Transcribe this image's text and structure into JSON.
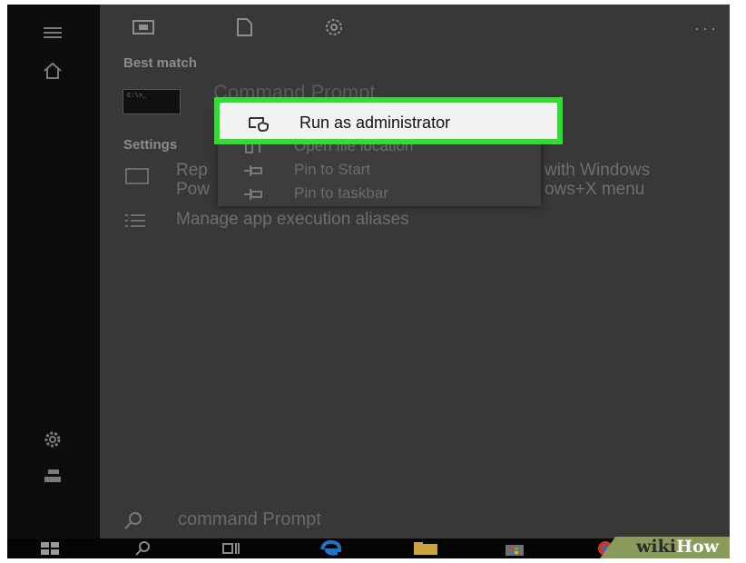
{
  "best_match": {
    "heading": "Best match",
    "app_title": "Command Prompt",
    "thumb_text": "C:\\>_"
  },
  "context_menu": {
    "items": [
      {
        "label": "Run as administrator",
        "icon": "shield-window-icon",
        "highlighted": true
      },
      {
        "label": "Open file location",
        "icon": "folder-icon",
        "highlighted": false
      },
      {
        "label": "Pin to Start",
        "icon": "pin-icon",
        "highlighted": false
      },
      {
        "label": "Pin to taskbar",
        "icon": "pin-icon",
        "highlighted": false
      }
    ],
    "highlight_color": "#2de02d"
  },
  "settings": {
    "heading": "Settings",
    "item1_line1_left": "Rep",
    "item1_line1_right": "with Windows",
    "item1_line2_left": "Pow",
    "item1_line2_right": "ows+X menu",
    "item2": "Manage app execution aliases"
  },
  "search": {
    "query": "command Prompt"
  },
  "watermark": {
    "part1": "wiki",
    "part2": "How"
  },
  "colors": {
    "panel": "#383838",
    "rail": "#0d0d0d",
    "taskbar": "#050505"
  }
}
